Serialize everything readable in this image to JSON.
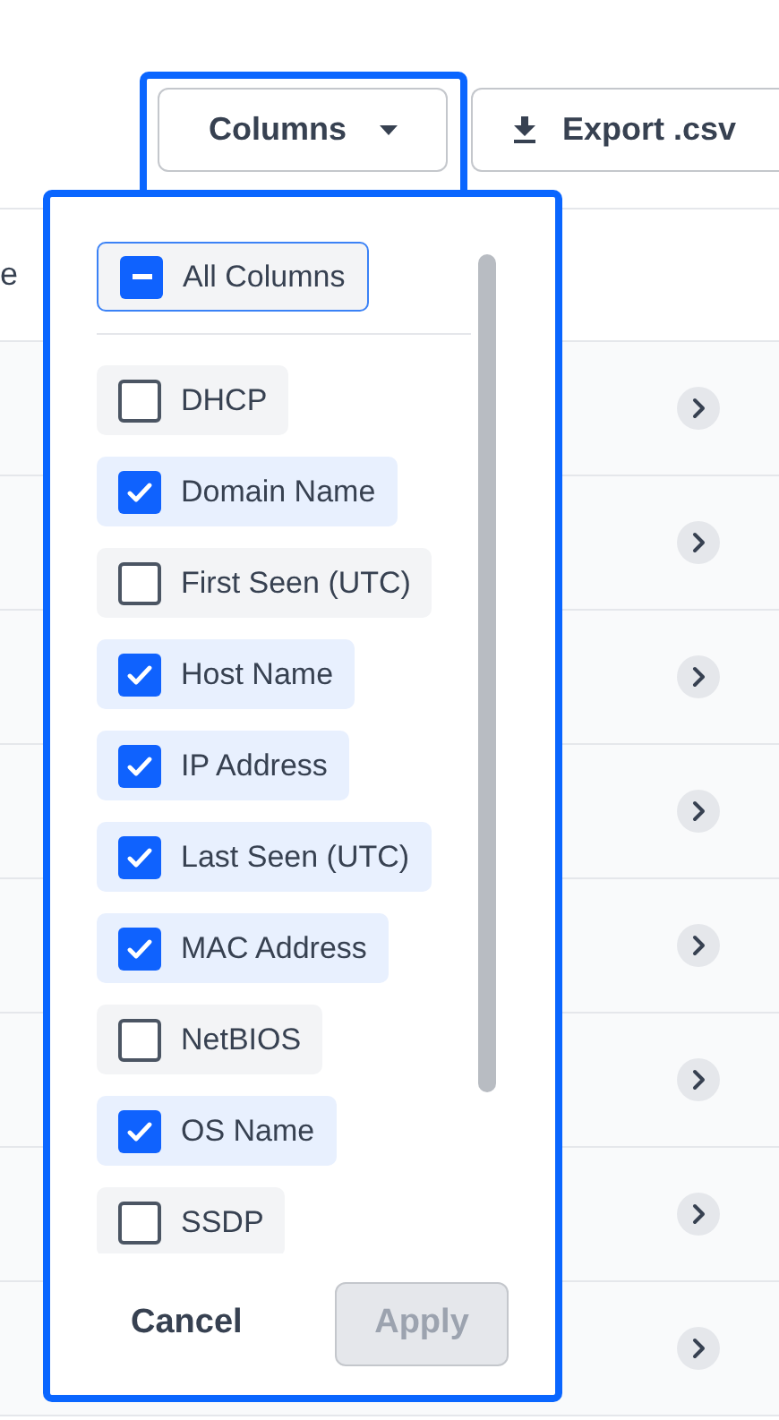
{
  "toolbar": {
    "columns_button": {
      "label": "Columns"
    },
    "export_button": {
      "label": "Export .csv"
    }
  },
  "table": {
    "header_fragment": "e",
    "rows": [
      {
        "expandable": true
      },
      {
        "expandable": true
      },
      {
        "expandable": true
      },
      {
        "expandable": true
      },
      {
        "expandable": true
      },
      {
        "expandable": true
      },
      {
        "expandable": true
      },
      {
        "expandable": true
      }
    ]
  },
  "columns_menu": {
    "all_columns": {
      "label": "All Columns",
      "indeterminate": true
    },
    "items": [
      {
        "label": "DHCP",
        "checked": false
      },
      {
        "label": "Domain Name",
        "checked": true
      },
      {
        "label": "First Seen (UTC)",
        "checked": false
      },
      {
        "label": "Host Name",
        "checked": true
      },
      {
        "label": "IP Address",
        "checked": true
      },
      {
        "label": "Last Seen (UTC)",
        "checked": true
      },
      {
        "label": "MAC Address",
        "checked": true
      },
      {
        "label": "NetBIOS",
        "checked": false
      },
      {
        "label": "OS Name",
        "checked": true
      },
      {
        "label": "SSDP",
        "checked": false
      }
    ],
    "cancel": "Cancel",
    "apply": {
      "label": "Apply",
      "disabled": true
    }
  }
}
